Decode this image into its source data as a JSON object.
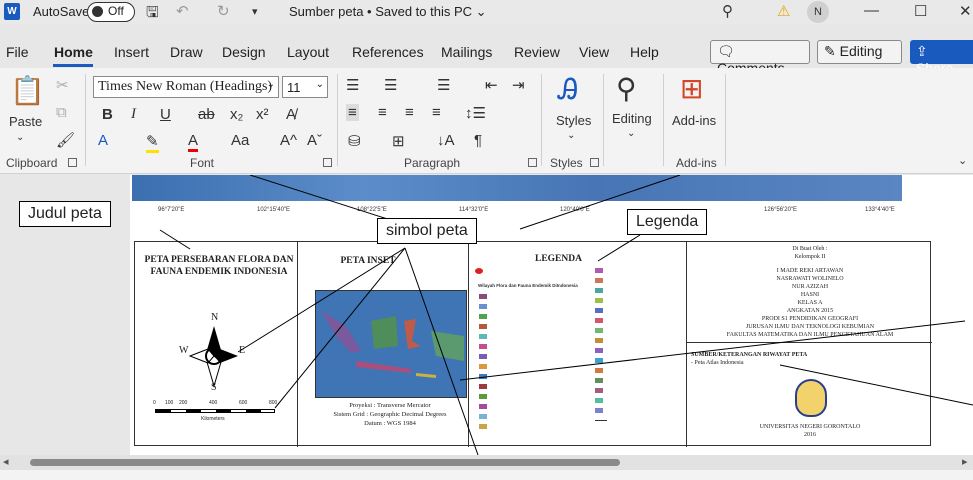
{
  "titlebar": {
    "app_logo": "W",
    "autosave_label": "AutoSave",
    "autosave_state": "Off",
    "doc_title": "Sumber peta • Saved to this PC ⌄",
    "user_initial": "N",
    "warning_icon": "warning-icon"
  },
  "menu": {
    "tabs": [
      "File",
      "Home",
      "Insert",
      "Draw",
      "Design",
      "Layout",
      "References",
      "Mailings",
      "Review",
      "View",
      "Help"
    ],
    "active": "Home",
    "comments": "Comments",
    "editing": "Editing",
    "share": "Share"
  },
  "ribbon": {
    "clipboard": {
      "paste": "Paste",
      "label": "Clipboard"
    },
    "font": {
      "name": "Times New Roman (Headings)",
      "size": "11",
      "label": "Font"
    },
    "paragraph": {
      "label": "Paragraph"
    },
    "styles": {
      "button": "Styles",
      "label": "Styles"
    },
    "editing": {
      "button": "Editing"
    },
    "addins": {
      "button": "Add-ins",
      "label": "Add-ins"
    }
  },
  "document": {
    "coords": [
      "96°7'20\"E",
      "102°15'40\"E",
      "108°22'5\"E",
      "114°32'0\"E",
      "120°40'0\"E",
      "126°56'20\"E",
      "133°4'40\"E"
    ],
    "map_title": "PETA PERSEBARAN FLORA DAN FAUNA ENDEMIK INDONESIA",
    "compass": {
      "n": "N",
      "s": "S",
      "e": "E",
      "w": "W"
    },
    "scale_ticks": [
      "0",
      "100",
      "200",
      "400",
      "600",
      "800"
    ],
    "scale_unit": "Kilometers",
    "inset_title": "PETA INSET",
    "projection": "Proyeksi : Transverse Mercator",
    "grid_system": "Sistem Grid : Geographic Decimal Degrees",
    "datum": "Datum : WGS 1984",
    "legend_title": "LEGENDA",
    "legend_subtitle": "Wilayah Flora dan Fauna Endemik DiIndonesia",
    "author_header": "Di Buat Oleh :",
    "group": "Kelompok II",
    "members": [
      "I MADE REKI ARTAWAN",
      "NASRAWATI WOLINELO",
      "NUR AZIZAH",
      "HASNI"
    ],
    "class": "KELAS A",
    "batch": "ANGKATAN 2015",
    "program": "PRODI S1 PENDIDIKAN GEOGRAFI",
    "department": "JURUSAN ILMU DAN TEKNOLOGI KEBUMIAN",
    "faculty": "FAKULTAS MATEMATIKA DAN ILMU PENGETAHUAN ALAM",
    "source_header": "SUMBER/KETERANGAN RIWAYAT PETA",
    "source_item": "- Peta Atlas Indonesia",
    "university": "UNIVERSITAS NEGERI GORONTALO",
    "year": "2016"
  },
  "callouts": {
    "judul": "Judul peta",
    "simbol": "simbol peta",
    "legenda": "Legenda"
  },
  "colors": {
    "accent": "#185abd",
    "warning": "#e8a600"
  }
}
